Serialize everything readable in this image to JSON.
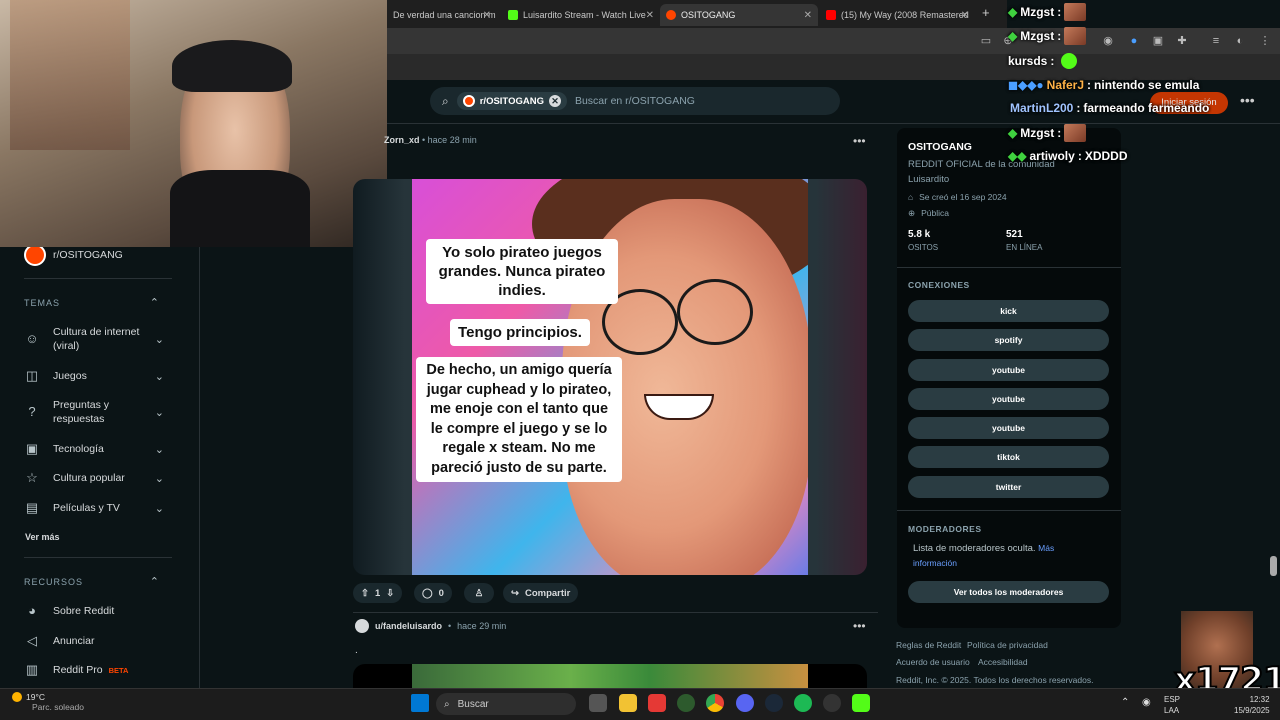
{
  "browser": {
    "tabs": [
      {
        "label": "De verdad una cancion m",
        "color": "#e53935"
      },
      {
        "label": "Luisardito Stream - Watch Live",
        "color": "#53fc18"
      },
      {
        "label": "OSITOGANG",
        "color": "#ff4500"
      },
      {
        "label": "(15) My Way (2008 Remastered",
        "color": "#ff0000"
      }
    ],
    "new_tab": "+"
  },
  "header": {
    "chip_label": "r/OSITOGANG",
    "search_placeholder": "Buscar en r/OSITOGANG",
    "login_label": "Iniciar sesión",
    "more": "•••"
  },
  "sidebar": {
    "community": "r/OSITOGANG",
    "temas_heading": "TEMAS",
    "temas": [
      {
        "label": "Cultura de internet (viral)",
        "icon": "smile-icon"
      },
      {
        "label": "Juegos",
        "icon": "gamepad-icon"
      },
      {
        "label": "Preguntas y respuestas",
        "icon": "question-icon"
      },
      {
        "label": "Tecnología",
        "icon": "chip-icon"
      },
      {
        "label": "Cultura popular",
        "icon": "star-icon"
      },
      {
        "label": "Películas y TV",
        "icon": "clapper-icon"
      }
    ],
    "ver_mas": "Ver más",
    "recursos_heading": "RECURSOS",
    "recursos": [
      {
        "label": "Sobre Reddit",
        "icon": "reddit-icon"
      },
      {
        "label": "Anunciar",
        "icon": "megaphone-icon"
      },
      {
        "label": "Reddit Pro",
        "icon": "chart-icon",
        "badge": "BETA"
      }
    ]
  },
  "post": {
    "author": "Zorn_xd",
    "time": "hace 28 min",
    "meme_text": [
      "Yo solo pirateo juegos grandes. Nunca pirateo indies.",
      "Tengo principios.",
      "De hecho, un amigo quería jugar cuphead y lo pirateo, me enoje con el tanto que le compre el juego y se lo regale x steam. No me pareció justo de su parte."
    ],
    "votes": "1",
    "comments": "0",
    "share_label": "Compartir"
  },
  "post2": {
    "author": "u/fandeluisardo",
    "time": "hace 29 min",
    "body": "."
  },
  "community_card": {
    "name": "OSITOGANG",
    "description": "REDDIT OFICIAL de la comunidad Luisardito",
    "created": "Se creó el 16 sep 2024",
    "visibility": "Pública",
    "members_count": "5.8 k",
    "members_label": "OSITOS",
    "online_count": "521",
    "online_label": "EN LÍNEA",
    "connections_heading": "CONEXIONES",
    "connections": [
      "kick",
      "spotify",
      "youtube",
      "youtube",
      "youtube",
      "tiktok",
      "twitter"
    ],
    "moderators_heading": "MODERADORES",
    "moderators_text": "Lista de moderadores oculta.",
    "moderators_link": "Más información",
    "moderators_button": "Ver todos los moderadores"
  },
  "footer": {
    "links": [
      "Reglas de Reddit",
      "Política de privacidad",
      "Acuerdo de usuario",
      "Accesibilidad"
    ],
    "copyright": "Reddit, Inc. © 2025. Todos los derechos reservados."
  },
  "chat": [
    {
      "user": "Mzgst",
      "msg": "",
      "emote": true
    },
    {
      "user": "Mzgst",
      "msg": "",
      "emote": true
    },
    {
      "user": "kursds",
      "msg": "",
      "emote": false
    },
    {
      "user": "NaferJ",
      "msg": "nintendo se emula",
      "emote": false
    },
    {
      "user": "MartinL200",
      "msg": "farmeando farmeando",
      "emote": false
    },
    {
      "user": "Mzgst",
      "msg": "",
      "emote": true
    },
    {
      "user": "artiwoly",
      "msg": "XDDDD",
      "emote": false
    }
  ],
  "overlay": {
    "counter": "x1721"
  },
  "taskbar": {
    "weather_temp": "19°C",
    "weather_desc": "Parc. soleado",
    "search_label": "Buscar",
    "lang_1": "ESP",
    "lang_2": "LAA",
    "time": "12:32",
    "date": "15/9/2025"
  }
}
